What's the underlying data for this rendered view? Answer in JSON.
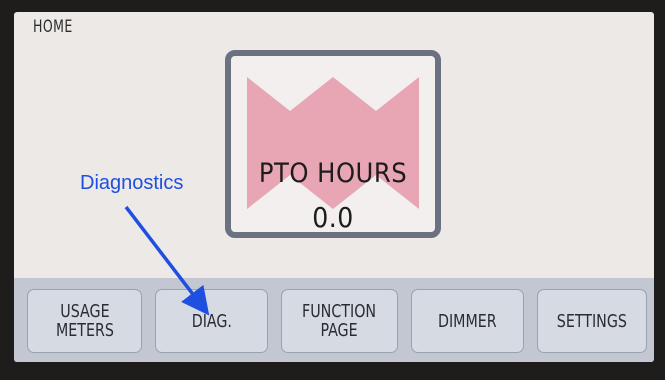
{
  "screen": {
    "title": "HOME"
  },
  "pto_display": {
    "label": "PTO HOURS",
    "value": "0.0",
    "logo_color": "#e8a5b4",
    "frame_color": "#6b7180"
  },
  "softkeys": [
    {
      "label": "USAGE\nMETERS"
    },
    {
      "label": "DIAG."
    },
    {
      "label": "FUNCTION\nPAGE"
    },
    {
      "label": "DIMMER"
    },
    {
      "label": "SETTINGS"
    }
  ],
  "annotation": {
    "text": "Diagnostics",
    "color": "#1f4fe0"
  }
}
